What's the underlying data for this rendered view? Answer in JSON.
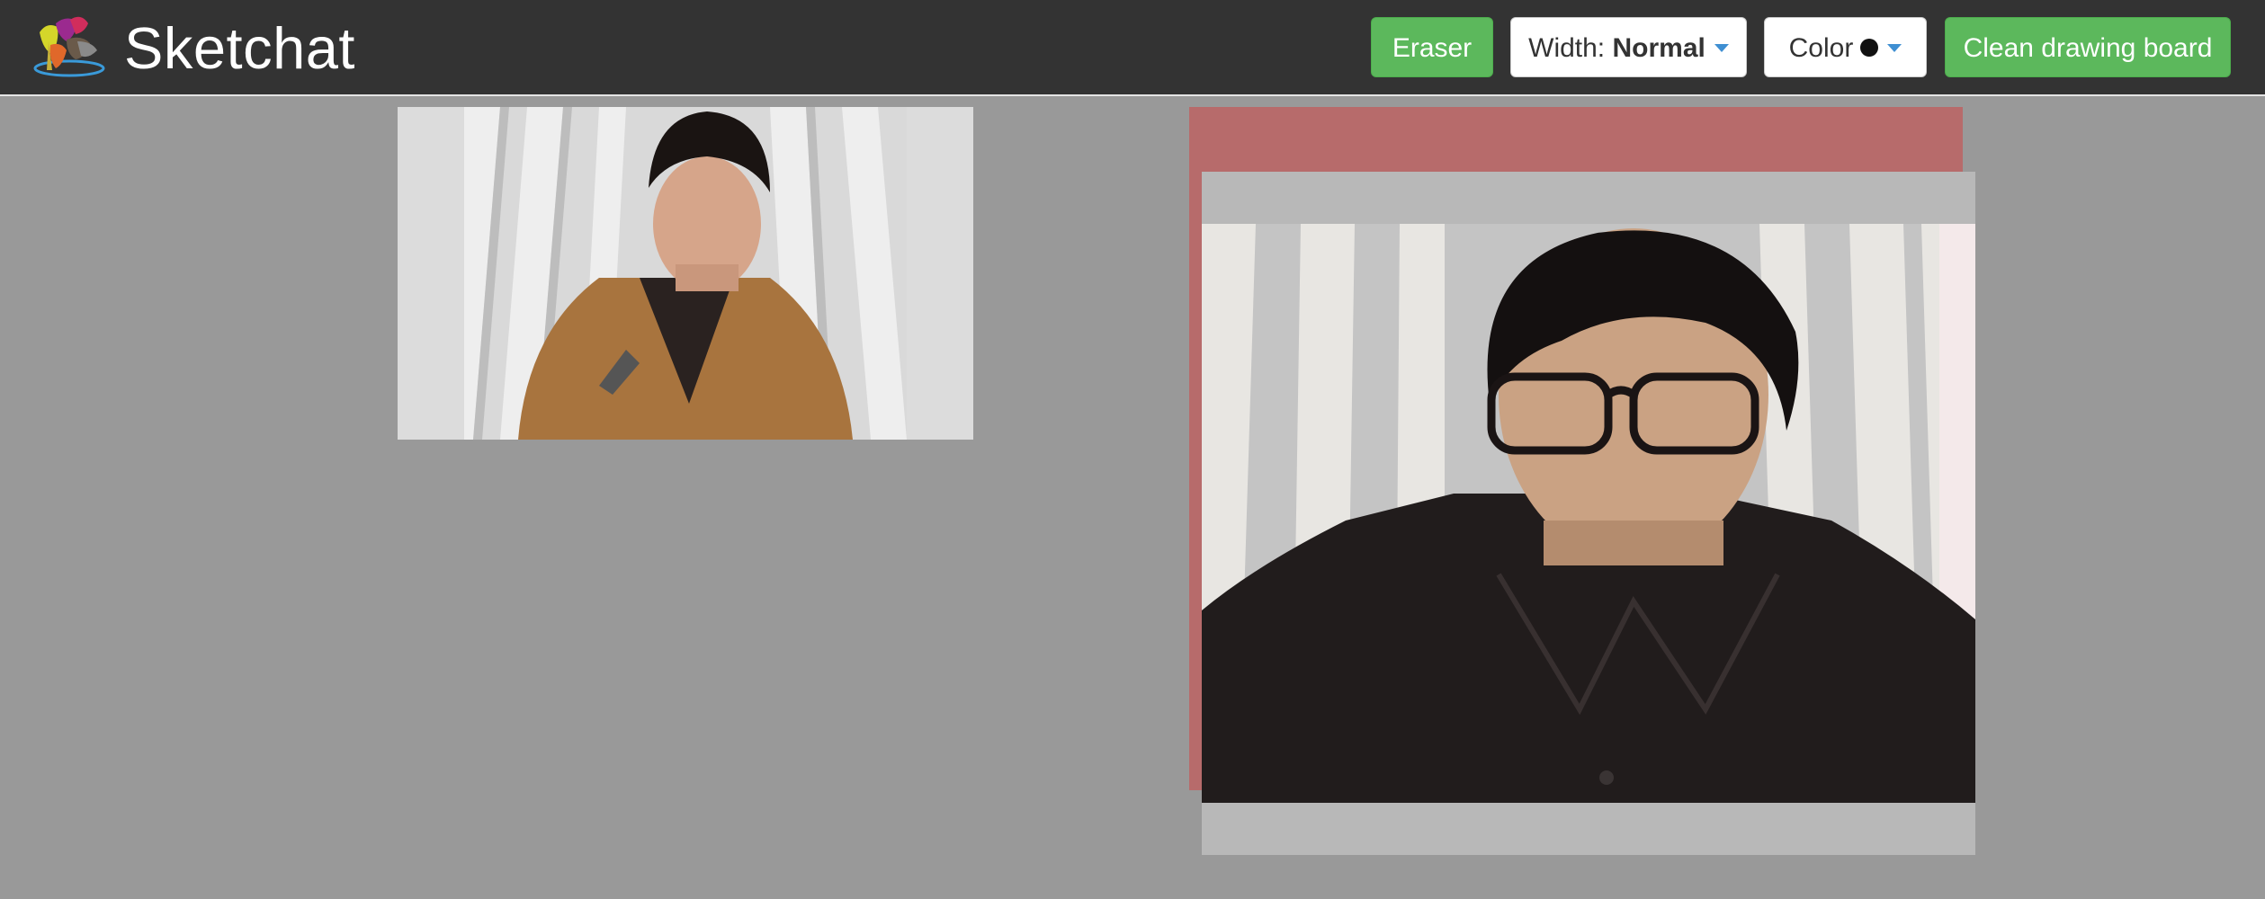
{
  "app": {
    "title": "Sketchat",
    "logo_icon": "paint-splash-logo-icon"
  },
  "toolbar": {
    "eraser_label": "Eraser",
    "width_prefix": "Width:",
    "width_value": "Normal",
    "color_label": "Color",
    "color_value": "#111111",
    "clean_label": "Clean drawing board"
  },
  "videos": {
    "local": {
      "label": "local-video-feed"
    },
    "remote": {
      "label": "remote-video-feed"
    }
  },
  "colors": {
    "navbar_bg": "#333333",
    "page_bg": "#999999",
    "button_green": "#5cb85c",
    "drawing_board_bg": "#b76b6b",
    "caret_blue": "#3f8fd2"
  }
}
